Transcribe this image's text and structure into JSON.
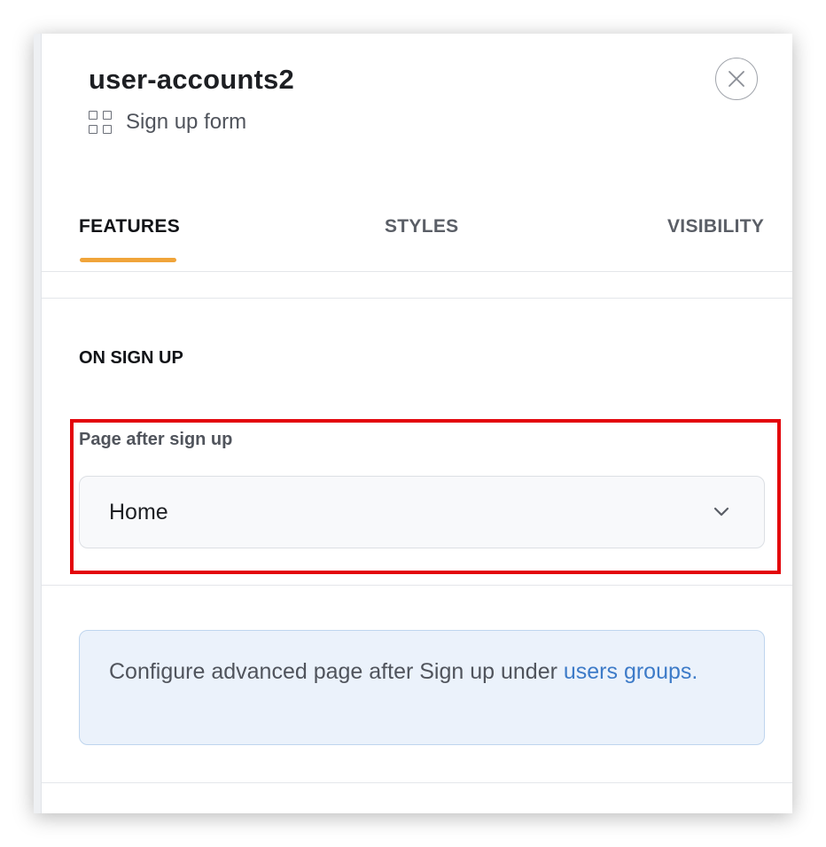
{
  "panel": {
    "title": "user-accounts2",
    "subtitle": "Sign up form",
    "subtitle_icon": "grid-icon",
    "close_icon": "close-icon"
  },
  "tabs": [
    {
      "label": "FEATURES",
      "active": true
    },
    {
      "label": "STYLES",
      "active": false
    },
    {
      "label": "VISIBILITY",
      "active": false
    }
  ],
  "section": {
    "title": "ON SIGN UP",
    "field_label": "Page after sign up",
    "select_value": "Home",
    "select_icon": "chevron-down-icon"
  },
  "info": {
    "text": "Configure advanced page after Sign up under ",
    "link_text": "users groups."
  },
  "colors": {
    "tab_accent": "#f0a43a",
    "highlight": "#e3050b",
    "link": "#3d7bc8",
    "info_bg": "#ebf2fb"
  }
}
